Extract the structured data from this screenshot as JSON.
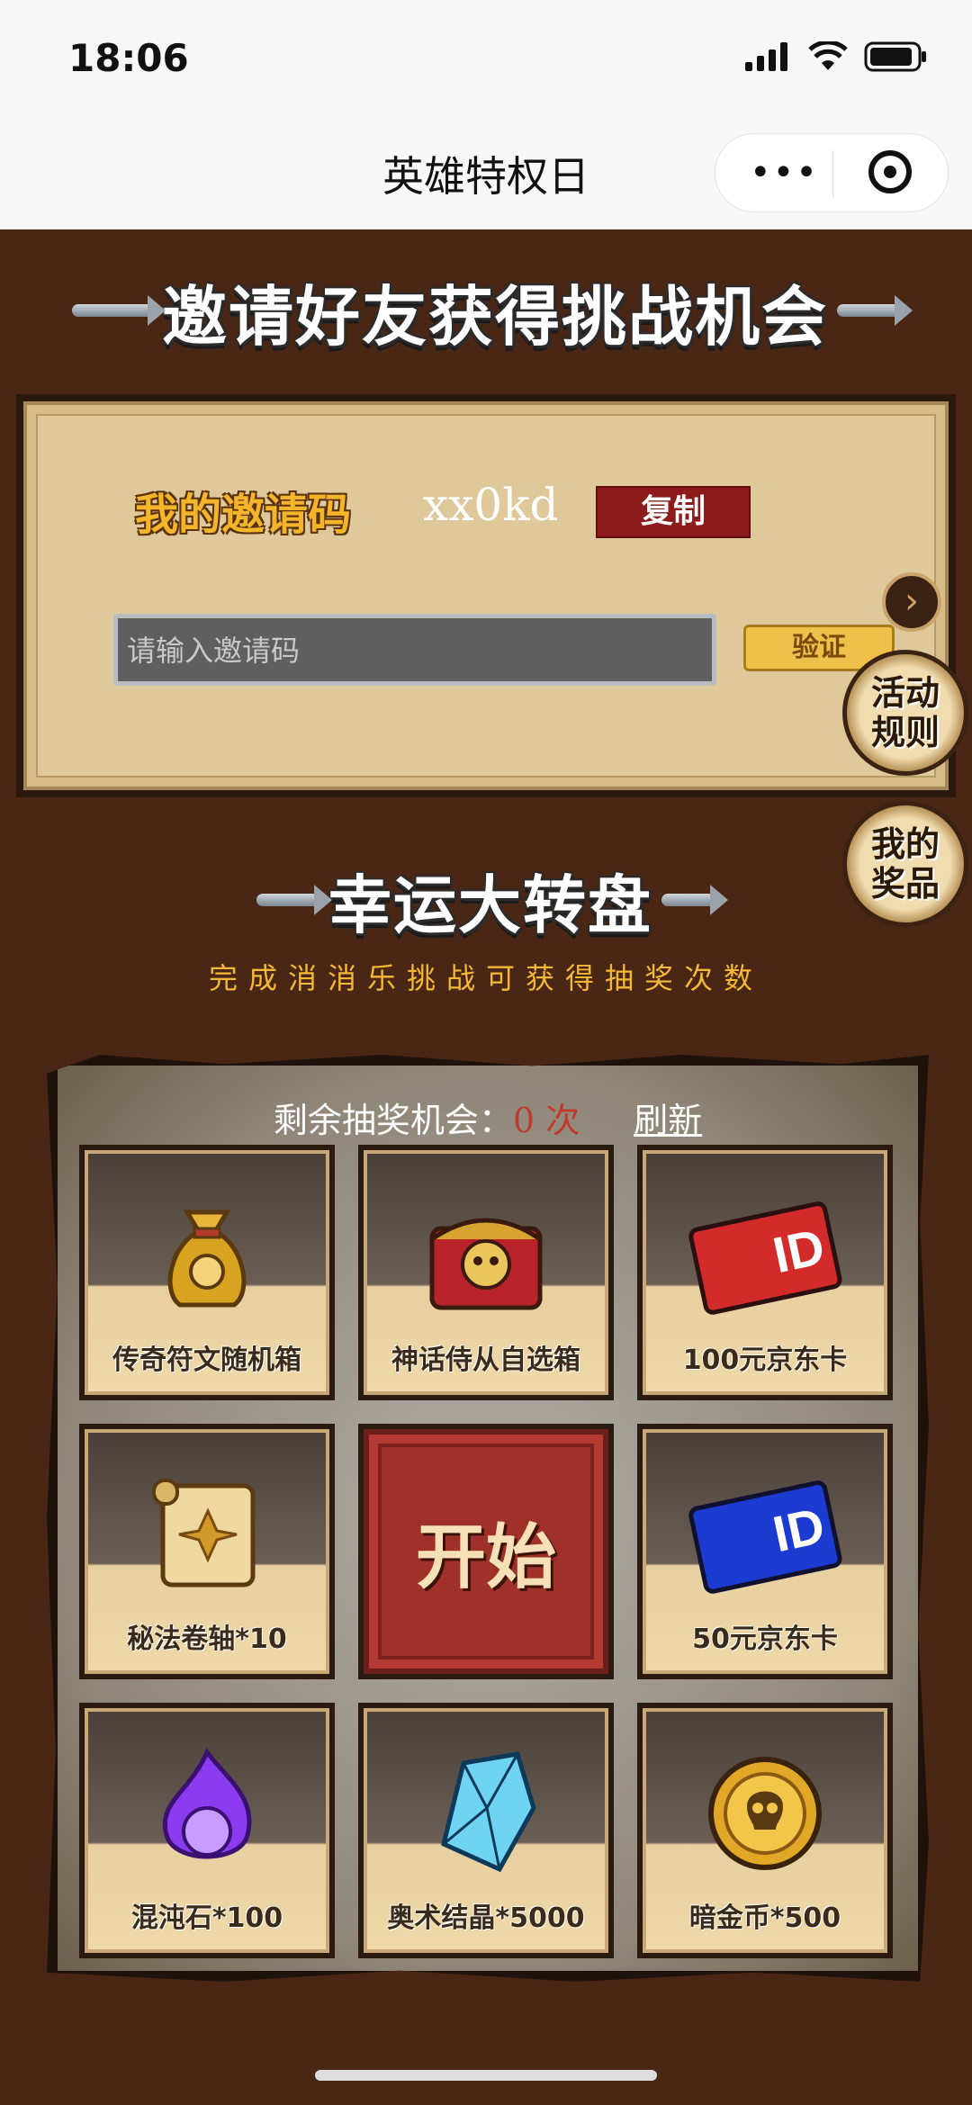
{
  "status_bar": {
    "time": "18:06"
  },
  "nav": {
    "title": "英雄特权日",
    "more": "•••"
  },
  "invite_section": {
    "banner": "邀请好友获得挑战机会",
    "my_code_label": "我的邀请码",
    "my_code_value": "xx0kd",
    "copy_label": "复制",
    "input_placeholder": "请输入邀请码",
    "verify_label": "验证"
  },
  "side_buttons": {
    "rules_line1": "活动",
    "rules_line2": "规则",
    "prizes_line1": "我的",
    "prizes_line2": "奖品",
    "next": "›"
  },
  "wheel_section": {
    "banner": "幸运大转盘",
    "subtitle": "完成消消乐挑战可获得抽奖次数",
    "chances_label": "剩余抽奖机会：",
    "chances_value": "0 次",
    "refresh_label": "刷新",
    "start_label": "开始",
    "prizes": [
      {
        "label": "传奇符文随机箱",
        "icon": "gold-bag-icon"
      },
      {
        "label": "神话侍从自选箱",
        "icon": "skull-chest-icon"
      },
      {
        "label": "100元京东卡",
        "icon": "red-jd-card-icon"
      },
      {
        "label": "秘法卷轴*10",
        "icon": "scroll-icon"
      },
      {
        "label": "50元京东卡",
        "icon": "blue-jd-card-icon"
      },
      {
        "label": "混沌石*100",
        "icon": "purple-flame-stone-icon"
      },
      {
        "label": "奥术结晶*5000",
        "icon": "blue-crystal-icon"
      },
      {
        "label": "暗金币*500",
        "icon": "skull-coin-icon"
      }
    ]
  },
  "colors": {
    "background": "#4a2614",
    "accent_gold": "#f3b838",
    "copy_red": "#8c1b1b",
    "start_red": "#a0302a"
  }
}
